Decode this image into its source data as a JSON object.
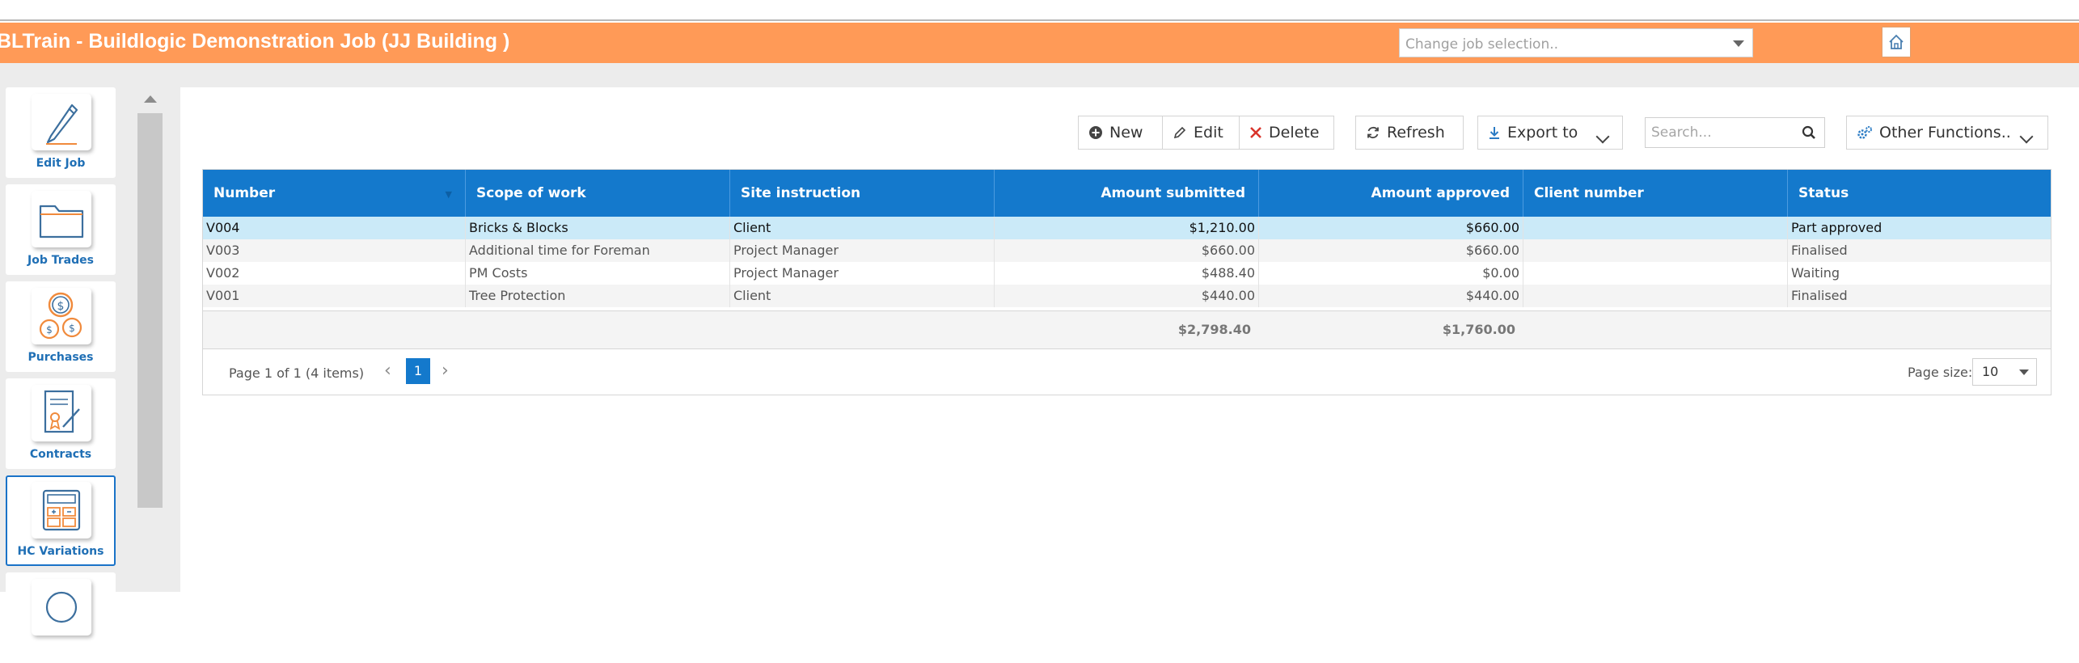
{
  "header": {
    "title": "BLTrain - Buildlogic Demonstration Job (JJ Building )",
    "job_select_placeholder": "Change job selection..",
    "home_icon": "home-icon",
    "bg_color": "#ff9a57"
  },
  "sidebar": {
    "items": [
      {
        "label": "Edit Job",
        "icon": "pencil-icon",
        "active": false
      },
      {
        "label": "Job Trades",
        "icon": "folder-icon",
        "active": false
      },
      {
        "label": "Purchases",
        "icon": "coins-icon",
        "active": false
      },
      {
        "label": "Contracts",
        "icon": "contract-icon",
        "active": false
      },
      {
        "label": "HC Variations",
        "icon": "calculator-icon",
        "active": true
      }
    ]
  },
  "toolbar": {
    "new_label": "New",
    "edit_label": "Edit",
    "delete_label": "Delete",
    "refresh_label": "Refresh",
    "export_label": "Export to",
    "search_placeholder": "Search...",
    "other_label": "Other Functions.."
  },
  "table": {
    "headers": {
      "number": "Number",
      "scope": "Scope of work",
      "site": "Site instruction",
      "submitted": "Amount submitted",
      "approved": "Amount approved",
      "client": "Client number",
      "status": "Status"
    },
    "rows": [
      {
        "number": "V004",
        "scope": "Bricks & Blocks",
        "site": "Client",
        "submitted": "$1,210.00",
        "approved": "$660.00",
        "client": "",
        "status": "Part approved"
      },
      {
        "number": "V003",
        "scope": "Additional time for Foreman",
        "site": "Project Manager",
        "submitted": "$660.00",
        "approved": "$660.00",
        "client": "",
        "status": "Finalised"
      },
      {
        "number": "V002",
        "scope": "PM Costs",
        "site": "Project Manager",
        "submitted": "$488.40",
        "approved": "$0.00",
        "client": "",
        "status": "Waiting"
      },
      {
        "number": "V001",
        "scope": "Tree Protection",
        "site": "Client",
        "submitted": "$440.00",
        "approved": "$440.00",
        "client": "",
        "status": "Finalised"
      }
    ],
    "totals": {
      "submitted": "$2,798.40",
      "approved": "$1,760.00"
    }
  },
  "pager": {
    "info": "Page 1 of 1 (4 items)",
    "current_page": "1",
    "size_label": "Page size:",
    "size_value": "10"
  },
  "colors": {
    "accent": "#1479cc",
    "selected_row": "#cbeaf8"
  }
}
